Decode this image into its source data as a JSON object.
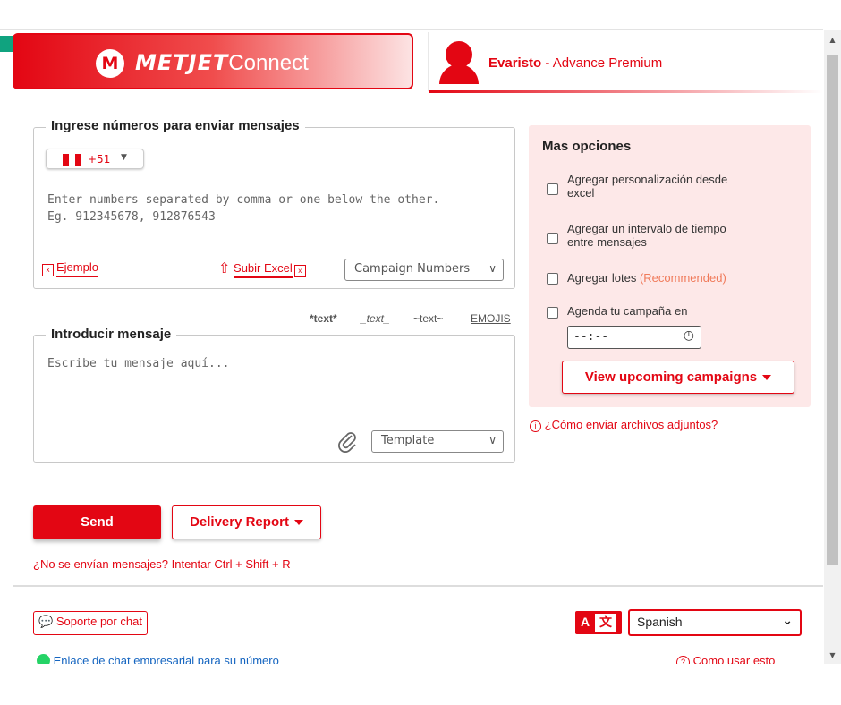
{
  "header": {
    "brand_bold": "METJET",
    "brand_rest": "Connect",
    "logo_letter": "M",
    "user_name": "Evaristo",
    "user_sep": " - ",
    "user_plan": "Advance Premium",
    "accent_color": "#e30613"
  },
  "numbers": {
    "legend": "Ingrese números para enviar mensajes",
    "country_code": "+51",
    "placeholder_line1": "Enter numbers separated by comma or one below the other.",
    "placeholder_line2": "Eg. 912345678, 912876543",
    "example_link": "Ejemplo",
    "upload_link": "Subir Excel",
    "campaign_select": "Campaign Numbers"
  },
  "format": {
    "bold": "*text*",
    "italic": "_text_",
    "strike": "~text~",
    "emojis": "EMOJIS"
  },
  "message": {
    "legend": "Introducir mensaje",
    "placeholder": "Escribe tu mensaje aquí...",
    "template_select": "Template"
  },
  "options": {
    "title": "Mas opciones",
    "items": [
      {
        "line1": "Agregar personalización desde",
        "line2": "excel",
        "checked": false
      },
      {
        "line1": "Agregar un intervalo de tiempo",
        "line2": "entre mensajes",
        "checked": false
      },
      {
        "line1": "Agregar lotes",
        "tag": "(Recommended)",
        "checked": false
      },
      {
        "line1": "Agenda tu campaña en",
        "checked": false
      }
    ],
    "time_value": "--:--",
    "upcoming_button": "View upcoming campaigns",
    "attachments_help": "¿Cómo enviar archivos adjuntos?"
  },
  "actions": {
    "send": "Send",
    "delivery_report": "Delivery Report",
    "hint": "¿No se envían mensajes? Intentar Ctrl + Shift + R"
  },
  "footer": {
    "chat_support": "Soporte por chat",
    "business_link": "Enlace de chat empresarial para su número",
    "language": "Spanish",
    "how_to": "Como usar esto"
  }
}
